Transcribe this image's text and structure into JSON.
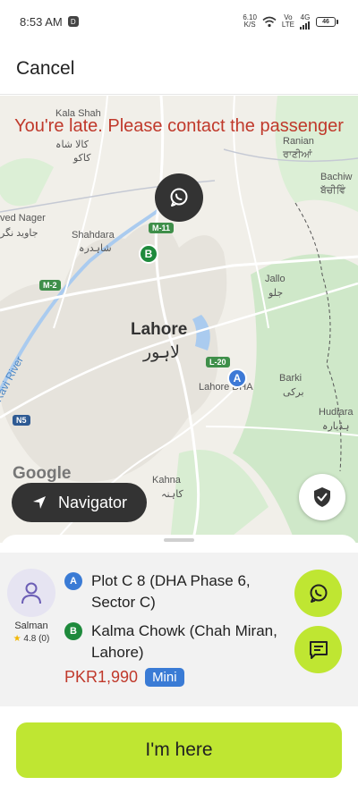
{
  "status_bar": {
    "time": "8:53 AM",
    "notification_glyph": "D",
    "net_speed_value": "6.10",
    "net_speed_unit": "K/S",
    "vo_lte_top": "Vo",
    "vo_lte_bottom": "LTE",
    "network_type": "4G",
    "battery_level": "46",
    "icons": [
      "wifi-icon",
      "signal-icon",
      "battery-icon"
    ]
  },
  "header": {
    "cancel_label": "Cancel"
  },
  "map": {
    "late_message": "You're late. Please contact the passenger",
    "city_name": "Lahore",
    "city_name_urdu": "لاہور",
    "place_labels": {
      "kala_shah": "Kala Shah",
      "kala_shah_urdu": "کالا شاہ",
      "kaku_urdu": "کاکو",
      "ranian": "Ranian",
      "ranian_punjabi": "ਰਾਣੀਆਂ",
      "bachiwind": "Bachiw",
      "bachiwind_punjabi": "ਬੱਚੀਵਿੰ",
      "javed_nagar": "ved Nager",
      "javed_nagar_urdu": "جاوید نگر",
      "shahdara": "Shahdara",
      "shahdara_urdu": "شاہدرہ",
      "jallo": "Jallo",
      "jallo_urdu": "جلو",
      "lahore_dha": "Lahore DHA",
      "barki": "Barki",
      "barki_urdu": "برکی",
      "hudiara": "Hudiara",
      "hudiara_urdu": "ہڈیارہ",
      "kahna": "Kahna",
      "kahna_urdu": "کاہنہ",
      "ravi_river": "Ravi River"
    },
    "road_shields": {
      "m11": "M-11",
      "m2": "M-2",
      "l20": "L-20",
      "n5": "N5"
    },
    "marker_a": "A",
    "marker_b": "B",
    "attribution": "Google",
    "navigator_label": "Navigator",
    "colors": {
      "land": "#f1efe9",
      "green": "#cfe8c9",
      "water": "#aacbef",
      "road": "#ffffff"
    }
  },
  "trip": {
    "rider_name": "Salman",
    "rating": "4.8 (0)",
    "pickup_badge": "A",
    "pickup": "Plot C 8 (DHA Phase 6, Sector C)",
    "dropoff_badge": "B",
    "dropoff": "Kalma Chowk (Chah Miran, Lahore)",
    "price": "PKR1,990",
    "tier": "Mini"
  },
  "actions": {
    "here_label": "I'm here"
  },
  "theme": {
    "accent": "#bfe632",
    "alert": "#c0392b",
    "badge_blue": "#3a7bd5",
    "badge_green": "#1e8a3c"
  }
}
